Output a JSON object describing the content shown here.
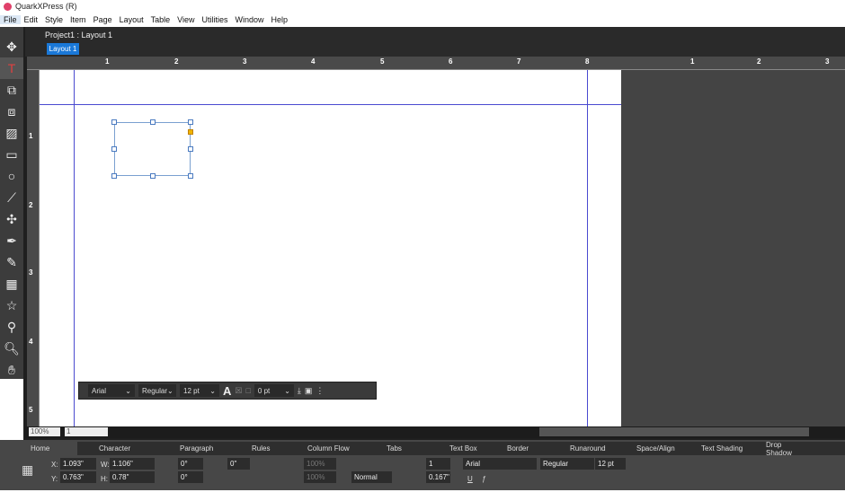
{
  "app": {
    "title": "QuarkXPress (R)"
  },
  "menu": [
    "File",
    "Edit",
    "Style",
    "Item",
    "Page",
    "Layout",
    "Table",
    "View",
    "Utilities",
    "Window",
    "Help"
  ],
  "document": {
    "project_title": "Project1 : Layout 1",
    "layout_tab": "Layout 1"
  },
  "rulers": {
    "horizontal": [
      "1",
      "2",
      "3",
      "4",
      "5",
      "6",
      "7",
      "8",
      "1",
      "2",
      "3"
    ],
    "vertical": [
      "1",
      "2",
      "3",
      "4",
      "5"
    ]
  },
  "tools": [
    "move-icon",
    "text-content-icon",
    "linking-icon",
    "unlinking-icon",
    "picture-content-icon",
    "rectangle-box-icon",
    "oval-box-icon",
    "line-icon",
    "bezier-icon",
    "pen-icon",
    "pencil-icon",
    "table-icon",
    "star-icon",
    "eyedropper-icon",
    "zoom-icon",
    "hand-icon"
  ],
  "floating_bar": {
    "font": "Arial",
    "style": "Regular",
    "size": "12 pt",
    "stroke": "0 pt"
  },
  "status": {
    "zoom": "100%",
    "page": "1"
  },
  "palette": {
    "tabs": [
      "Home",
      "Character",
      "Paragraph",
      "Rules",
      "Column Flow",
      "Tabs",
      "Text Box",
      "Border",
      "Runaround",
      "Space/Align",
      "Text Shading",
      "Drop Shadow"
    ],
    "x_label": "X:",
    "x": "1.093\"",
    "y_label": "Y:",
    "y": "0.763\"",
    "w_label": "W:",
    "w": "1.106\"",
    "h_label": "H:",
    "h": "0.78\"",
    "angle": "0°",
    "skew": "0°",
    "corner": "0\"",
    "opacity1": "100%",
    "opacity2": "100%",
    "blend": "Normal",
    "columns": "1",
    "gutter": "0.167\"",
    "font": "Arial",
    "style": "Regular",
    "size": "12 pt"
  },
  "colors": {
    "accent": "#1a78d8",
    "guide": "#4a4ad0"
  }
}
